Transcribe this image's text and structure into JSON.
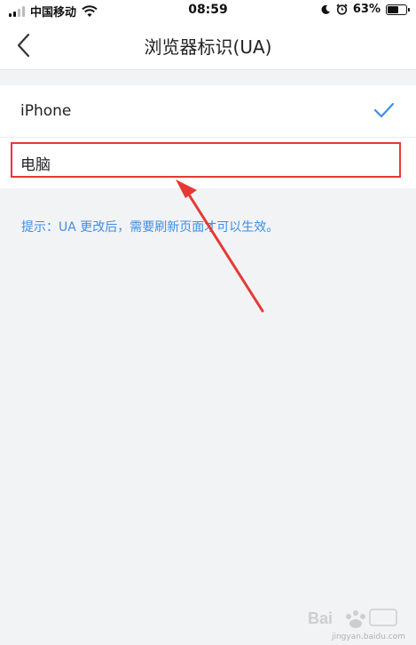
{
  "status_bar": {
    "carrier": "中国移动",
    "time": "08:59",
    "battery_percent": "63%",
    "battery_level": 0.63
  },
  "header": {
    "title": "浏览器标识(UA)",
    "back_icon": "chevron-left-icon"
  },
  "options": [
    {
      "label": "iPhone",
      "selected": true
    },
    {
      "label": "电脑",
      "selected": false
    }
  ],
  "tip": "提示：UA 更改后，需要刷新页面才可以生效。",
  "colors": {
    "accent": "#3d8ee6",
    "highlight": "#e53935",
    "background": "#f2f3f5"
  },
  "watermark": {
    "text": "jingyan.baidu.com"
  }
}
